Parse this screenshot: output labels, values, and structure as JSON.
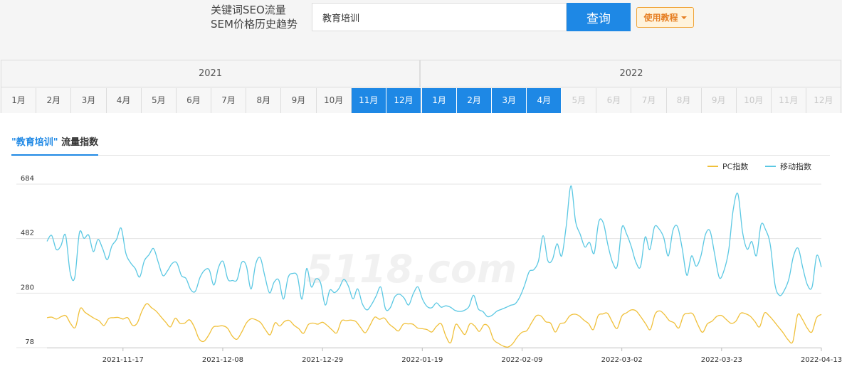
{
  "header": {
    "title_line1": "关键词SEO流量",
    "title_line2": "SEM价格历史趋势",
    "search_value": "教育培训",
    "search_button": "查询",
    "tutorial_button": "使用教程"
  },
  "timeline": {
    "years": [
      "2021",
      "2022"
    ],
    "months_2021": [
      {
        "label": "1月",
        "state": "normal"
      },
      {
        "label": "2月",
        "state": "normal"
      },
      {
        "label": "3月",
        "state": "normal"
      },
      {
        "label": "4月",
        "state": "normal"
      },
      {
        "label": "5月",
        "state": "normal"
      },
      {
        "label": "6月",
        "state": "normal"
      },
      {
        "label": "7月",
        "state": "normal"
      },
      {
        "label": "8月",
        "state": "normal"
      },
      {
        "label": "9月",
        "state": "normal"
      },
      {
        "label": "10月",
        "state": "normal"
      },
      {
        "label": "11月",
        "state": "active"
      },
      {
        "label": "12月",
        "state": "active"
      }
    ],
    "months_2022": [
      {
        "label": "1月",
        "state": "active"
      },
      {
        "label": "2月",
        "state": "active"
      },
      {
        "label": "3月",
        "state": "active"
      },
      {
        "label": "4月",
        "state": "active"
      },
      {
        "label": "5月",
        "state": "disabled"
      },
      {
        "label": "6月",
        "state": "disabled"
      },
      {
        "label": "7月",
        "state": "disabled"
      },
      {
        "label": "8月",
        "state": "disabled"
      },
      {
        "label": "9月",
        "state": "disabled"
      },
      {
        "label": "10月",
        "state": "disabled"
      },
      {
        "label": "11月",
        "state": "disabled"
      },
      {
        "label": "12月",
        "state": "disabled"
      }
    ],
    "colors": {
      "active": "#1e88e5",
      "disabled": "#c8c8c8"
    }
  },
  "tab": {
    "keyword_label": "\"教育培训\"",
    "suffix_label": "流量指数"
  },
  "watermark": "5118.com",
  "chart_data": {
    "type": "line",
    "title": "",
    "xlabel": "",
    "ylabel": "",
    "ylim": [
      78,
      684
    ],
    "yticks": [
      78,
      280,
      482,
      684
    ],
    "xticks": [
      "2021-11-17",
      "2021-12-08",
      "2021-12-29",
      "2022-01-19",
      "2022-02-09",
      "2022-03-02",
      "2022-03-23",
      "2022-04-13"
    ],
    "x_start": "2021-11-01",
    "x_end": "2022-04-13",
    "grid": true,
    "legend_position": "top-right",
    "series": [
      {
        "name": "PC指数",
        "color": "#f0c03a",
        "values": [
          189,
          191,
          184,
          193,
          196,
          166,
          154,
          223,
          209,
          197,
          186,
          177,
          160,
          186,
          189,
          190,
          184,
          189,
          161,
          169,
          214,
          241,
          226,
          213,
          192,
          172,
          155,
          187,
          168,
          169,
          181,
          155,
          111,
          101,
          123,
          154,
          157,
          159,
          150,
          121,
          109,
          136,
          170,
          185,
          181,
          170,
          144,
          126,
          170,
          158,
          175,
          179,
          161,
          148,
          131,
          163,
          169,
          165,
          172,
          160,
          144,
          133,
          177,
          178,
          180,
          175,
          153,
          133,
          161,
          191,
          183,
          188,
          166,
          152,
          140,
          165,
          166,
          165,
          151,
          148,
          145,
          136,
          157,
          166,
          119,
          97,
          163,
          147,
          127,
          166,
          159,
          138,
          163,
          154,
          108,
          94,
          84,
          80,
          92,
          117,
          135,
          141,
          170,
          196,
          195,
          174,
          169,
          136,
          166,
          171,
          195,
          202,
          196,
          180,
          167,
          145,
          196,
          203,
          205,
          173,
          149,
          195,
          207,
          218,
          214,
          192,
          167,
          145,
          202,
          214,
          200,
          178,
          170,
          151,
          198,
          205,
          202,
          163,
          135,
          166,
          176,
          194,
          197,
          182,
          168,
          176,
          205,
          204,
          195,
          175,
          155,
          206,
          196,
          176,
          154,
          132,
          107,
          101,
          199,
          183,
          151,
          136,
          189,
          201
        ]
      },
      {
        "name": "移动指数",
        "color": "#5bc8e3",
        "values": [
          472,
          494,
          442,
          455,
          495,
          356,
          339,
          504,
          483,
          495,
          434,
          479,
          445,
          404,
          455,
          479,
          521,
          428,
          393,
          372,
          340,
          400,
          422,
          445,
          394,
          345,
          363,
          390,
          392,
          345,
          334,
          293,
          287,
          338,
          365,
          366,
          310,
          376,
          397,
          332,
          327,
          330,
          394,
          381,
          295,
          387,
          411,
          342,
          281,
          321,
          328,
          258,
          338,
          353,
          343,
          258,
          371,
          303,
          333,
          318,
          236,
          291,
          282,
          298,
          331,
          306,
          259,
          296,
          241,
          218,
          238,
          270,
          302,
          222,
          225,
          266,
          276,
          262,
          236,
          278,
          303,
          257,
          230,
          226,
          244,
          228,
          233,
          228,
          216,
          212,
          216,
          230,
          272,
          222,
          212,
          193,
          198,
          213,
          220,
          227,
          235,
          241,
          267,
          309,
          360,
          367,
          400,
          493,
          401,
          404,
          463,
          418,
          532,
          678,
          545,
          498,
          451,
          468,
          428,
          545,
          539,
          456,
          393,
          381,
          524,
          499,
          453,
          395,
          378,
          488,
          441,
          525,
          518,
          486,
          418,
          513,
          526,
          444,
          346,
          418,
          380,
          416,
          497,
          510,
          423,
          337,
          364,
          437,
          590,
          648,
          507,
          443,
          471,
          419,
          534,
          514,
          458,
          311,
          271,
          290,
          333,
          418,
          446,
          374,
          310,
          303,
          419,
          377
        ]
      }
    ]
  }
}
